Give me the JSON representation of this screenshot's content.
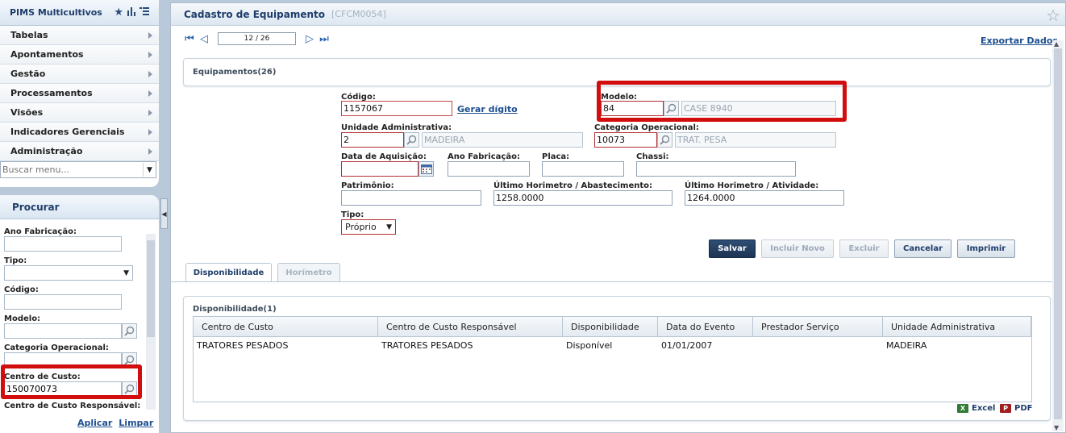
{
  "menu": {
    "title": "PIMS Multicultivos",
    "items": [
      {
        "label": "Tabelas"
      },
      {
        "label": "Apontamentos"
      },
      {
        "label": "Gestão"
      },
      {
        "label": "Processamentos"
      },
      {
        "label": "Visões"
      },
      {
        "label": "Indicadores Gerenciais"
      },
      {
        "label": "Administração"
      }
    ],
    "search_placeholder": "Buscar menu..."
  },
  "search_panel": {
    "title": "Procurar",
    "fields": {
      "ano_fabricacao": {
        "label": "Ano Fabricação:",
        "value": ""
      },
      "tipo": {
        "label": "Tipo:",
        "value": ""
      },
      "codigo": {
        "label": "Código:",
        "value": ""
      },
      "modelo": {
        "label": "Modelo:",
        "value": ""
      },
      "categoria_operacional": {
        "label": "Categoria Operacional:",
        "value": ""
      },
      "centro_custo": {
        "label": "Centro de Custo:",
        "value": "150070073"
      },
      "centro_custo_resp": {
        "label": "Centro de Custo Responsável:"
      }
    },
    "apply_label": "Aplicar",
    "clear_label": "Limpar"
  },
  "main": {
    "title": "Cadastro de Equipamento",
    "code": "[CFCM0054]",
    "pager": {
      "value": "12 / 26"
    },
    "export_label": "Exportar Dados",
    "equip_section_title": "Equipamentos(26)",
    "form": {
      "codigo": {
        "label": "Código:",
        "value": "1157067",
        "gerar_label": "Gerar dígito"
      },
      "modelo": {
        "label": "Modelo:",
        "value": "84",
        "desc": "CASE 8940"
      },
      "unidade_adm": {
        "label": "Unidade Administrativa:",
        "value": "2",
        "desc": "MADEIRA"
      },
      "categoria_op": {
        "label": "Categoria Operacional:",
        "value": "10073",
        "desc": "TRAT. PESA"
      },
      "data_aquisicao": {
        "label": "Data de Aquisição:",
        "value": ""
      },
      "ano_fabricacao": {
        "label": "Ano Fabricação:",
        "value": ""
      },
      "placa": {
        "label": "Placa:",
        "value": ""
      },
      "chassi": {
        "label": "Chassi:",
        "value": ""
      },
      "patrimonio": {
        "label": "Patrimônio:",
        "value": ""
      },
      "ult_hor_abast": {
        "label": "Último Horimetro / Abastecimento:",
        "value": "1258.0000"
      },
      "ult_hor_ativ": {
        "label": "Último Horimetro / Atividade:",
        "value": "1264.0000"
      },
      "tipo": {
        "label": "Tipo:",
        "value": "Próprio"
      }
    },
    "buttons": {
      "salvar": "Salvar",
      "incluir_novo": "Incluir Novo",
      "excluir": "Excluir",
      "cancelar": "Cancelar",
      "imprimir": "Imprimir"
    },
    "tabs": [
      {
        "label": "Disponibilidade"
      },
      {
        "label": "Horímetro"
      }
    ],
    "disponibilidade": {
      "title": "Disponibilidade(1)",
      "columns": [
        "Centro de Custo",
        "Centro de Custo Responsável",
        "Disponibilidade",
        "Data do Evento",
        "Prestador Serviço",
        "Unidade Administrativa"
      ],
      "rows": [
        [
          "TRATORES PESADOS",
          "TRATORES PESADOS",
          "Disponível",
          "01/01/2007",
          "",
          "MADEIRA"
        ]
      ],
      "excel_label": "Excel",
      "pdf_label": "PDF"
    }
  },
  "colors": {
    "accent": "#1e3d6b",
    "highlight": "#d10d0d",
    "primary_button": "#1d3555"
  }
}
